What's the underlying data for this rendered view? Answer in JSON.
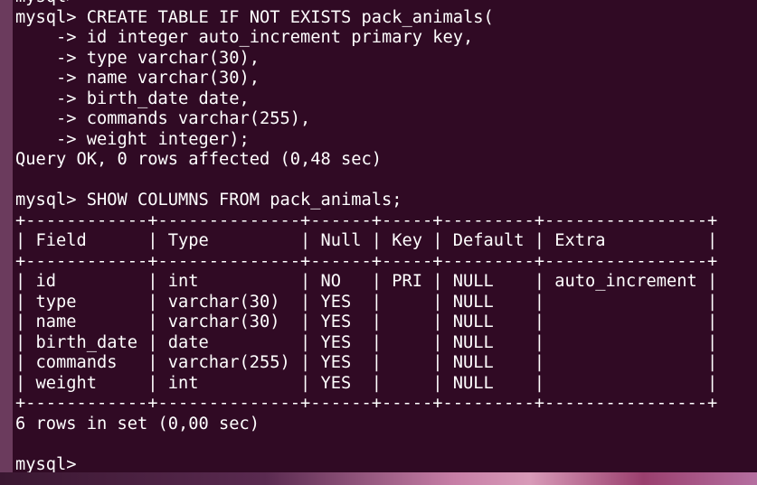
{
  "terminal": {
    "lines": [
      "mysql> ",
      "mysql> CREATE TABLE IF NOT EXISTS pack_animals(",
      "    -> id integer auto_increment primary key,",
      "    -> type varchar(30),",
      "    -> name varchar(30),",
      "    -> birth_date date,",
      "    -> commands varchar(255),",
      "    -> weight integer);",
      "Query OK, 0 rows affected (0,48 sec)",
      "",
      "mysql> SHOW COLUMNS FROM pack_animals;",
      "+------------+--------------+------+-----+---------+----------------+",
      "| Field      | Type         | Null | Key | Default | Extra          |",
      "+------------+--------------+------+-----+---------+----------------+",
      "| id         | int          | NO   | PRI | NULL    | auto_increment |",
      "| type       | varchar(30)  | YES  |     | NULL    |                |",
      "| name       | varchar(30)  | YES  |     | NULL    |                |",
      "| birth_date | date         | YES  |     | NULL    |                |",
      "| commands   | varchar(255) | YES  |     | NULL    |                |",
      "| weight     | int          | YES  |     | NULL    |                |",
      "+------------+--------------+------+-----+---------+----------------+",
      "6 rows in set (0,00 sec)",
      "",
      "mysql> "
    ]
  },
  "colors": {
    "terminal_background": "#300a24",
    "text": "#ffffff"
  }
}
